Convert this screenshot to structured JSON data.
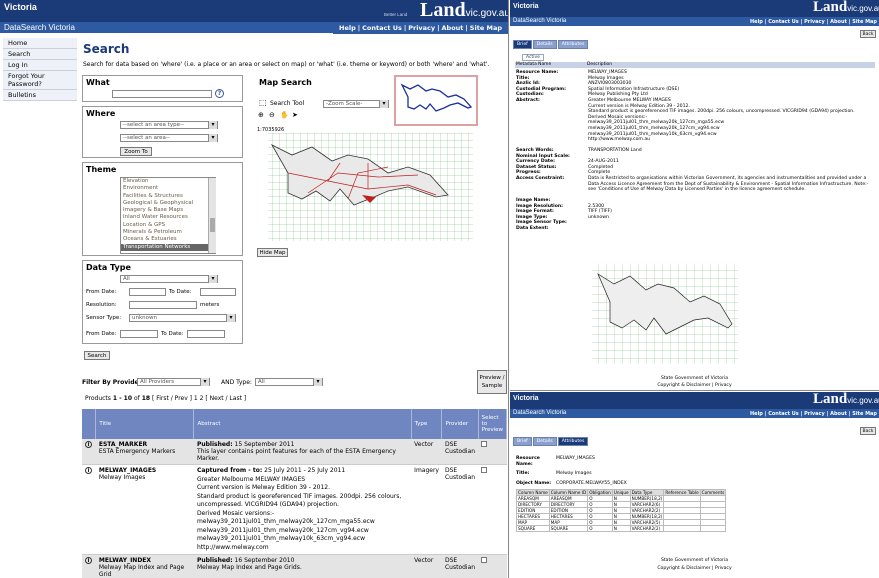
{
  "left": {
    "banner": {
      "brand": "Victoria",
      "site_word": "Land",
      "site_domain": "vic.gov.au",
      "tagline": "Better Land",
      "app_title": "DataSearch Victoria"
    },
    "topnav": [
      "Help",
      "Contact Us",
      "Privacy",
      "About",
      "Site Map"
    ],
    "sidebar": [
      "Home",
      "Search",
      "Log In",
      "Forgot Your Password?",
      "Bulletins"
    ],
    "heading": "Search",
    "intro": "Search for data based on 'where' (i.e. a place or an area or select on map) or 'what' (i.e. theme or keyword) or both 'where' and 'what'.",
    "what": {
      "title": "What",
      "help": "?"
    },
    "where": {
      "title": "Where",
      "area_type": "--select an area type--",
      "area": "--select an area--",
      "zoom": "Zoom To"
    },
    "theme": {
      "title": "Theme",
      "items": [
        "Elevation",
        "Environment",
        "Facilities & Structures",
        "Geological & Geophysical",
        "Imagery & Base Maps",
        "Inland Water Resources",
        "Location & GPS",
        "Minerals & Petroleum",
        "Oceans & Estuaries",
        "Transportation Networks"
      ],
      "selected": "Transportation Networks"
    },
    "datatype": {
      "title": "Data Type",
      "value": "All",
      "from": "From Date:",
      "to": "To Date:",
      "resolution": "Resolution:",
      "meters": "meters",
      "sensor": "Sensor Type:",
      "sensor_value": "unknown",
      "from2": "From Date:",
      "to2": "To Date:",
      "search": "Search"
    },
    "map": {
      "title": "Map Search",
      "search_tool": "Search Tool",
      "zoom_scale": "-Zoom Scale-",
      "scale": "1:7035926",
      "hide": "Hide Map"
    },
    "filter": {
      "label": "Filter By Provider:",
      "provider": "All Providers",
      "and_type": "AND Type:",
      "type": "All"
    },
    "preview_btn": "Preview / Sample",
    "paging": {
      "products": "Products",
      "range": "1 - 10",
      "of": "of",
      "total": "18",
      "nav": "[ First / Prev ] 1 2 [ Next / Last ]"
    },
    "table": {
      "headers": [
        "Title",
        "Abstract",
        "Type",
        "Provider",
        "Select to Preview"
      ],
      "rows": [
        {
          "name": "ESTA_MARKER",
          "sub": "ESTA Emergency Markers",
          "pub_label": "Published:",
          "pub": "15 September 2011",
          "abstract": [
            "This layer contains point features for each of the ESTA Emergency Marker."
          ],
          "type": "Vector",
          "provider": "DSE Custodian"
        },
        {
          "name": "MELWAY_IMAGES",
          "sub": "Melway Images",
          "pub_label": "Captured from - to:",
          "pub": "25 July 2011 - 25 July 2011",
          "abstract": [
            "Greater Melbourne MELWAY IMAGES",
            "Current version is Melway Edition 39 - 2012.",
            "Standard product is georeferenced TIF images. 200dpi. 256 colours,",
            "uncompressed. VICGRID94 (GDA94) projection.",
            "Derived Mosaic versions:-",
            "melway39_2011jul01_thm_melway20k_127cm_mga55.ecw",
            "melway39_2011jul01_thm_melway20k_127cm_vg94.ecw",
            "melway39_2011jul01_thm_melway10k_63cm_vg94.ecw",
            "http://www.melway.com"
          ],
          "type": "Imagery",
          "provider": "DSE Custodian"
        },
        {
          "name": "MELWAY_INDEX",
          "sub": "Melway Map Index and Page Grid",
          "pub_label": "Published:",
          "pub": "16 September 2010",
          "abstract": [
            "Melway Map Index and Page Grids."
          ],
          "type": "Vector",
          "provider": "DSE Custodian"
        }
      ]
    }
  },
  "topright": {
    "banner": {
      "brand": "Victoria",
      "site_word": "Land",
      "site_domain": "vic.gov.au",
      "app_title": "DataSearch Victoria"
    },
    "topnav": [
      "Help",
      "Contact Us",
      "Privacy",
      "About",
      "Site Map"
    ],
    "back": "Back",
    "tabs": [
      "Brief",
      "Details",
      "Attributes"
    ],
    "subtab": "Active",
    "meta_header": [
      "Metadata Name",
      "Description"
    ],
    "fields": [
      {
        "k": "Resource Name:",
        "v": "MELWAY_IMAGES"
      },
      {
        "k": "Title:",
        "v": "Melway Images"
      },
      {
        "k": "Anzlic Id:",
        "v": "ANZVI0803003030"
      },
      {
        "k": "Custodial Program:",
        "v": "Spatial Information Infrastructure (DSE)"
      },
      {
        "k": "Custodian:",
        "v": "Melway Publishing Pty Ltd"
      },
      {
        "k": "Abstract:",
        "v": "Greater Melbourne MELWAY IMAGES\nCurrent version is Melway Edition 39 - 2012.\nStandard product is georeferenced TIF images. 200dpi. 256 colours, uncompressed. VICGRID94 (GDA94) projection.\nDerived Mosaic versions:-\nmelway39_2011jul01_thm_melway20k_127cm_mga55.ecw\nmelway39_2011jul01_thm_melway20k_127cm_vg94.ecw\nmelway39_2011jul01_thm_melway10k_63cm_vg94.ecw\nhttp://www.melway.com.au"
      },
      {
        "k": "Search Words:",
        "v": "TRANSPORTATION Land"
      },
      {
        "k": "Nominal Input Scale:",
        "v": ""
      },
      {
        "k": "Currency Date:",
        "v": "24-AUG-2011"
      },
      {
        "k": "Dataset Status:",
        "v": "Completed"
      },
      {
        "k": "Progress:",
        "v": "Complete"
      },
      {
        "k": "Access Constraint:",
        "v": "Data is Restricted to organisations within Victorian Government, its agencies and instrumentalities and provided under a Data Access Licence Agreement from the Dept of Sustainability & Environment - Spatial Information Infrastructure. Note:- see 'Conditions of Use of Melway Data by Licensed Parties' in the licence agreement schedule."
      },
      {
        "k": "Image Name:",
        "v": ""
      },
      {
        "k": "Image Resolution:",
        "v": "2.5300"
      },
      {
        "k": "Image Format:",
        "v": "TIFF (TIFF)"
      },
      {
        "k": "Image Type:",
        "v": "unknown"
      },
      {
        "k": "Image Sensor Type:",
        "v": ""
      },
      {
        "k": "Data Extent:",
        "v": ""
      }
    ],
    "footer1": "State Government of Victoria",
    "footer2": "Copyright & Disclaimer | Privacy"
  },
  "bottomright": {
    "banner": {
      "brand": "Victoria",
      "site_word": "Land",
      "site_domain": "vic.gov.au",
      "app_title": "DataSearch Victoria"
    },
    "topnav": [
      "Help",
      "Contact Us",
      "Privacy",
      "About",
      "Site Map"
    ],
    "back": "Back",
    "tabs": [
      "Brief",
      "Details",
      "Attributes"
    ],
    "fields": [
      {
        "k": "Resource Name:",
        "v": "MELWAY_IMAGES"
      },
      {
        "k": "Title:",
        "v": "Melway Images"
      },
      {
        "k": "Object Name:",
        "v": "CORPORATE.MELWAY55_INDEX"
      }
    ],
    "attr_headers": [
      "Column Name",
      "Column Name ID",
      "Obligation",
      "Unique",
      "Data Type",
      "Reference Table",
      "Comments"
    ],
    "attr_rows": [
      [
        "AREASQM",
        "AREASQM",
        "O",
        "N",
        "NUMBER(18,2)",
        "",
        ""
      ],
      [
        "DIRECTORY",
        "DIRECTORY",
        "O",
        "N",
        "VARCHAR2(6)",
        "",
        ""
      ],
      [
        "EDITION",
        "EDITION",
        "O",
        "N",
        "VARCHAR2(2)",
        "",
        ""
      ],
      [
        "HECTARES",
        "HECTARES",
        "O",
        "N",
        "NUMBER(18,2)",
        "",
        ""
      ],
      [
        "MAP",
        "MAP",
        "O",
        "N",
        "VARCHAR2(5)",
        "",
        ""
      ],
      [
        "SQUARE",
        "SQUARE",
        "O",
        "N",
        "VARCHAR2(2)",
        "",
        ""
      ]
    ],
    "footer1": "State Government of Victoria",
    "footer2": "Copyright & Disclaimer | Privacy"
  }
}
